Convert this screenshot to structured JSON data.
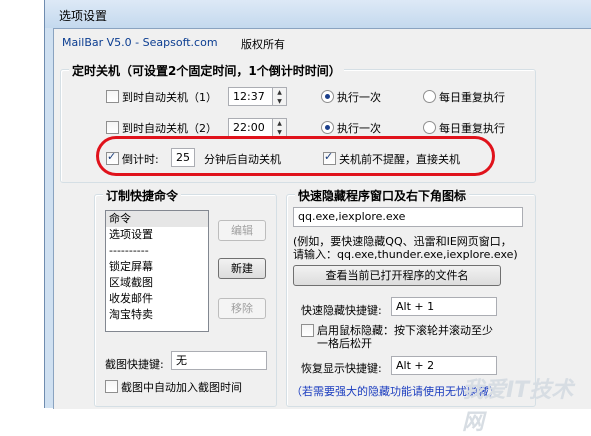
{
  "window": {
    "title": "选项设置"
  },
  "header": {
    "app_link": "MailBar V5.0 - Seapsoft.com",
    "copyright": "版权所有"
  },
  "shutdown_group": {
    "legend": "定时关机（可设置2个固定时间，1个倒计时时间）",
    "row1": {
      "checkbox_label": "到时自动关机（1）",
      "time": "12:37",
      "radio_once": "执行一次",
      "radio_daily": "每日重复执行"
    },
    "row2": {
      "checkbox_label": "到时自动关机（2）",
      "time": "22:00",
      "radio_once": "执行一次",
      "radio_daily": "每日重复执行"
    },
    "countdown": {
      "checkbox_label": "倒计时:",
      "minutes": "25",
      "suffix": "分钟后自动关机",
      "no_prompt_label": "关机前不提醒，直接关机"
    }
  },
  "shortcut_group": {
    "legend": "订制快捷命令",
    "items": [
      "命令",
      "选项设置",
      "----------",
      "锁定屏幕",
      "区域截图",
      "收发邮件",
      "淘宝特卖"
    ],
    "edit_btn": "编辑",
    "new_btn": "新建",
    "remove_btn": "移除",
    "screenshot_hotkey_label": "截图快捷键:",
    "screenshot_hotkey_value": "无",
    "add_time_label": "截图中自动加入截图时间"
  },
  "hide_group": {
    "legend": "快速隐藏程序窗口及右下角图标",
    "processes": "qq.exe,iexplore.exe",
    "example_line1": "(例如，要快速隐藏QQ、迅雷和IE网页窗口，",
    "example_line2": "请输入：qq.exe,thunder.exe,iexplore.exe)",
    "view_btn": "查看当前已打开程序的文件名",
    "hide_hotkey_label": "快速隐藏快捷键:",
    "hide_hotkey_value": "Alt + 1",
    "mouse_hide_line1": "启用鼠标隐藏：按下滚轮并滚动至少",
    "mouse_hide_line2": "一格后松开",
    "restore_hotkey_label": "恢复显示快捷键:",
    "restore_hotkey_value": "Alt + 2",
    "footer_note": "（若需要强大的隐藏功能请使用无忧隐藏）"
  },
  "watermark": "我爱IT技术网"
}
